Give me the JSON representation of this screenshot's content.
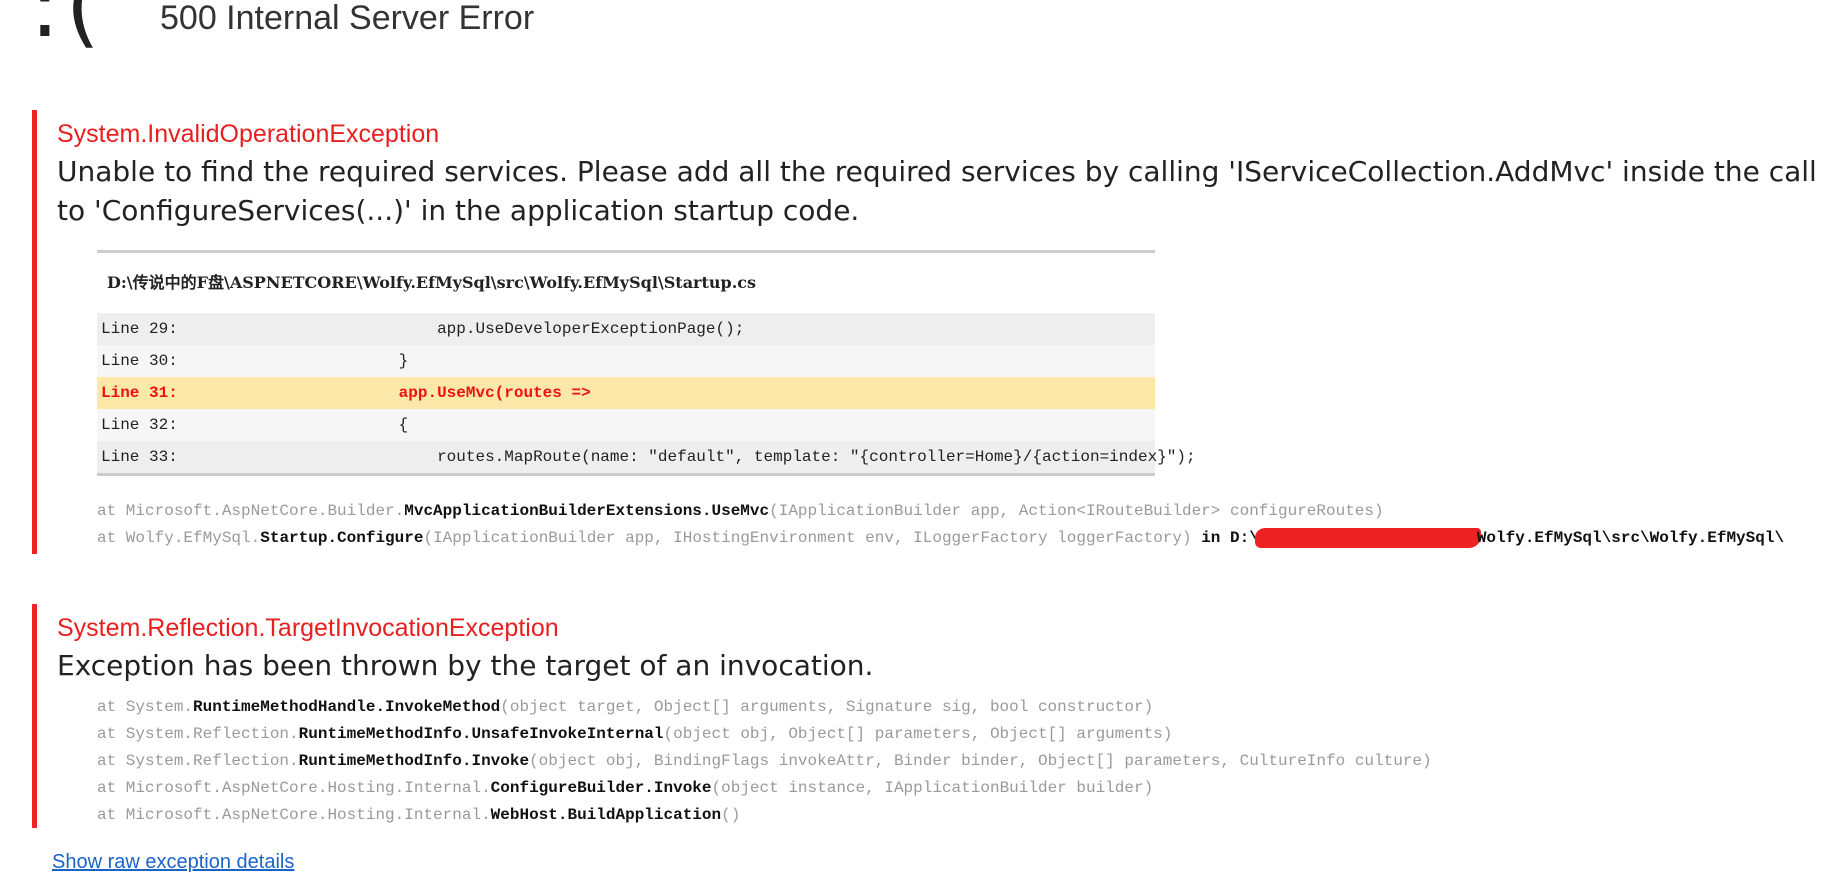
{
  "header": {
    "icon": "sad-face",
    "glyph": ":(",
    "title": "500 Internal Server Error"
  },
  "exceptions": [
    {
      "type": "System.InvalidOperationException",
      "message": "Unable to find the required services. Please add all the required services by calling 'IServiceCollection.AddMvc' inside the call to 'ConfigureServices(...)' in the application startup code.",
      "source": {
        "file": "D:\\传说中的F盘\\ASPNETCORE\\Wolfy.EfMySql\\src\\Wolfy.EfMySql\\Startup.cs",
        "lines": [
          {
            "num": "Line 29:",
            "code": "                app.UseDeveloperExceptionPage();"
          },
          {
            "num": "Line 30:",
            "code": "            }"
          },
          {
            "num": "Line 31:",
            "code": "            app.UseMvc(routes =>"
          },
          {
            "num": "Line 32:",
            "code": "            {"
          },
          {
            "num": "Line 33:",
            "code": "                routes.MapRoute(name: \"default\", template: \"{controller=Home}/{action=index}\");"
          }
        ]
      },
      "stack": [
        {
          "prefix": "at Microsoft.AspNetCore.Builder.",
          "method": "MvcApplicationBuilderExtensions.UseMvc",
          "args": "(IApplicationBuilder app, Action<IRouteBuilder> configureRoutes)",
          "loc_prefix": "",
          "loc_suffix": ""
        },
        {
          "prefix": "at Wolfy.EfMySql.",
          "method": "Startup.Configure",
          "args": "(IApplicationBuilder app, IHostingEnvironment env, ILoggerFactory loggerFactory) ",
          "loc_prefix": "in D:\\",
          "loc_suffix": "Wolfy.EfMySql\\src\\Wolfy.EfMySql\\"
        }
      ]
    },
    {
      "type": "System.Reflection.TargetInvocationException",
      "message": "Exception has been thrown by the target of an invocation.",
      "stack": [
        {
          "prefix": "at System.",
          "method": "RuntimeMethodHandle.InvokeMethod",
          "args": "(object target, Object[] arguments, Signature sig, bool constructor)"
        },
        {
          "prefix": "at System.Reflection.",
          "method": "RuntimeMethodInfo.UnsafeInvokeInternal",
          "args": "(object obj, Object[] parameters, Object[] arguments)"
        },
        {
          "prefix": "at System.Reflection.",
          "method": "RuntimeMethodInfo.Invoke",
          "args": "(object obj, BindingFlags invokeAttr, Binder binder, Object[] parameters, CultureInfo culture)"
        },
        {
          "prefix": "at Microsoft.AspNetCore.Hosting.Internal.",
          "method": "ConfigureBuilder.Invoke",
          "args": "(object instance, IApplicationBuilder builder)"
        },
        {
          "prefix": "at Microsoft.AspNetCore.Hosting.Internal.",
          "method": "WebHost.BuildApplication",
          "args": "()"
        }
      ]
    }
  ],
  "footer": {
    "raw_link": "Show raw exception details"
  },
  "colors": {
    "error_red": "#e81f1f",
    "highlight_bg": "#fce8a8",
    "link_blue": "#1a63c8"
  }
}
